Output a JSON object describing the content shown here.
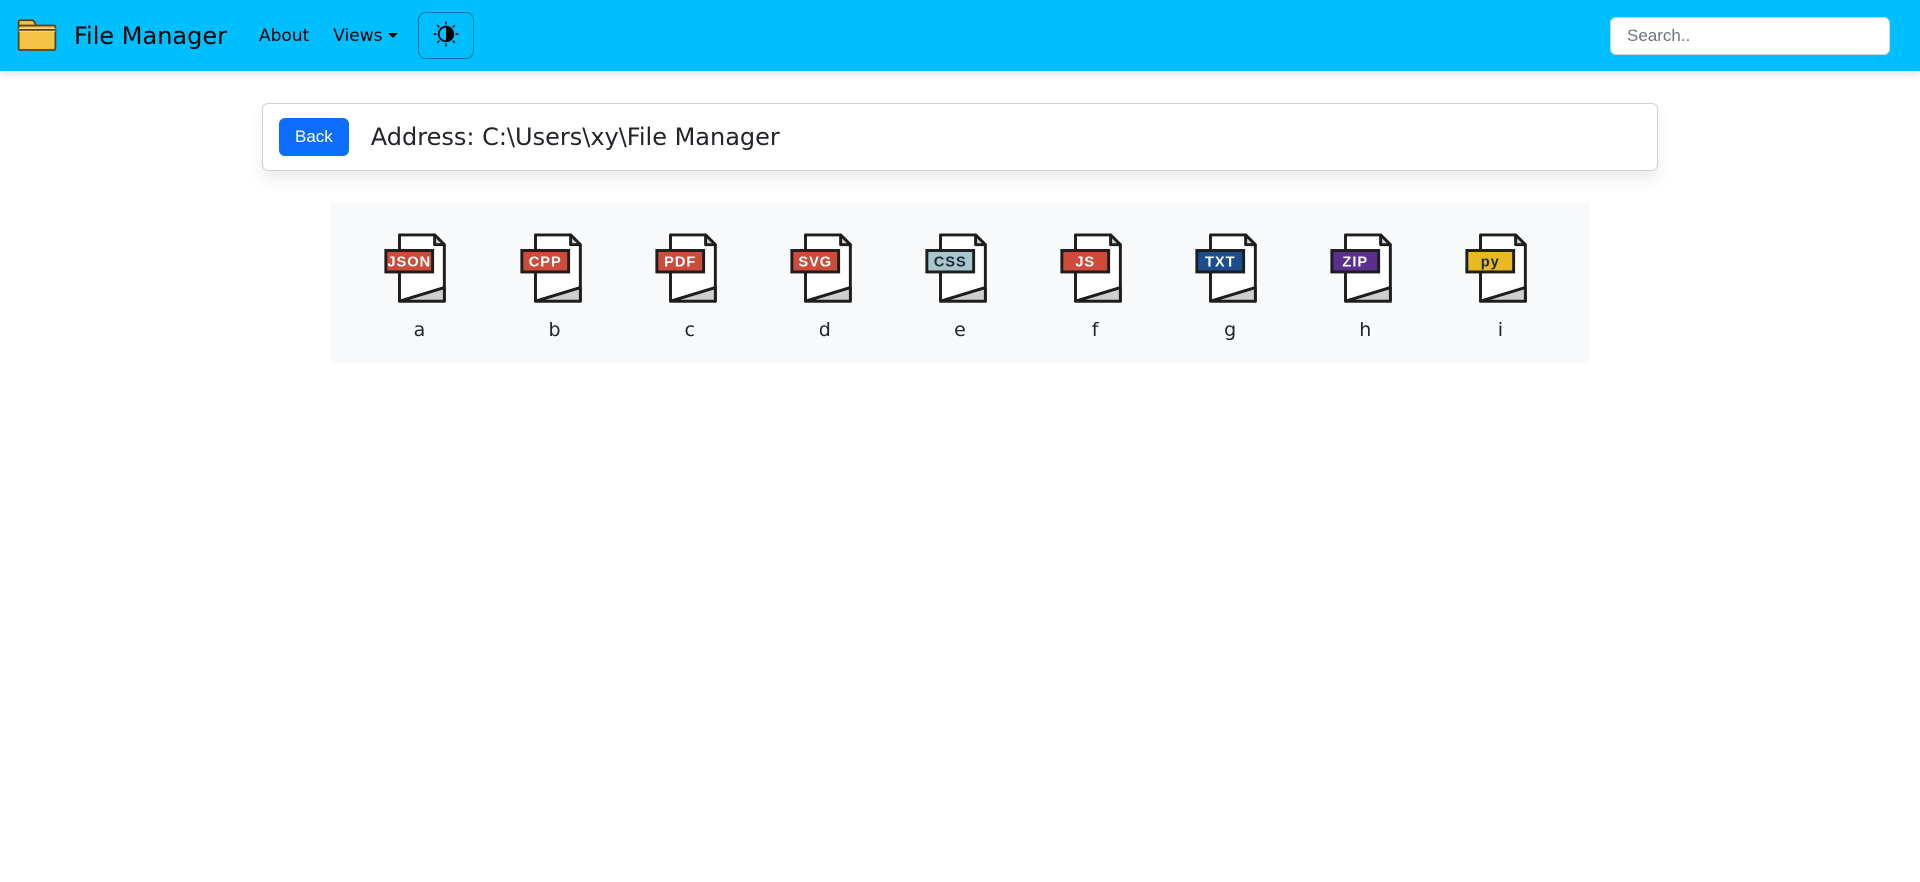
{
  "navbar": {
    "brand": "File Manager",
    "about": "About",
    "views": "Views"
  },
  "search": {
    "placeholder": "Search.."
  },
  "address": {
    "back_label": "Back",
    "text": "Address: C:\\Users\\xy\\File Manager"
  },
  "files": [
    {
      "name": "a",
      "type": "JSON",
      "badge_fill": "#CC4B3A",
      "badge_text": "#FFFFFF",
      "page_fill": "#FFFFFF"
    },
    {
      "name": "b",
      "type": "CPP",
      "badge_fill": "#CC4B3A",
      "badge_text": "#FFFFFF",
      "page_fill": "#FFFFFF"
    },
    {
      "name": "c",
      "type": "PDF",
      "badge_fill": "#CC4B3A",
      "badge_text": "#FFFFFF",
      "page_fill": "#FFFFFF"
    },
    {
      "name": "d",
      "type": "SVG",
      "badge_fill": "#CC4B3A",
      "badge_text": "#FFFFFF",
      "page_fill": "#FFFFFF"
    },
    {
      "name": "e",
      "type": "CSS",
      "badge_fill": "#A9C6CC",
      "badge_text": "#1A2C3A",
      "page_fill": "#FFFFFF"
    },
    {
      "name": "f",
      "type": "JS",
      "badge_fill": "#CC4B3A",
      "badge_text": "#FFFFFF",
      "page_fill": "#FFFFFF"
    },
    {
      "name": "g",
      "type": "TXT",
      "badge_fill": "#1C4E8E",
      "badge_text": "#FFFFFF",
      "page_fill": "#FFFFFF"
    },
    {
      "name": "h",
      "type": "ZIP",
      "badge_fill": "#5B2F8E",
      "badge_text": "#FFFFFF",
      "page_fill": "#FFFFFF"
    },
    {
      "name": "i",
      "type": "py",
      "badge_fill": "#E8B923",
      "badge_text": "#1A2C3A",
      "page_fill": "#FFFFFF"
    }
  ]
}
